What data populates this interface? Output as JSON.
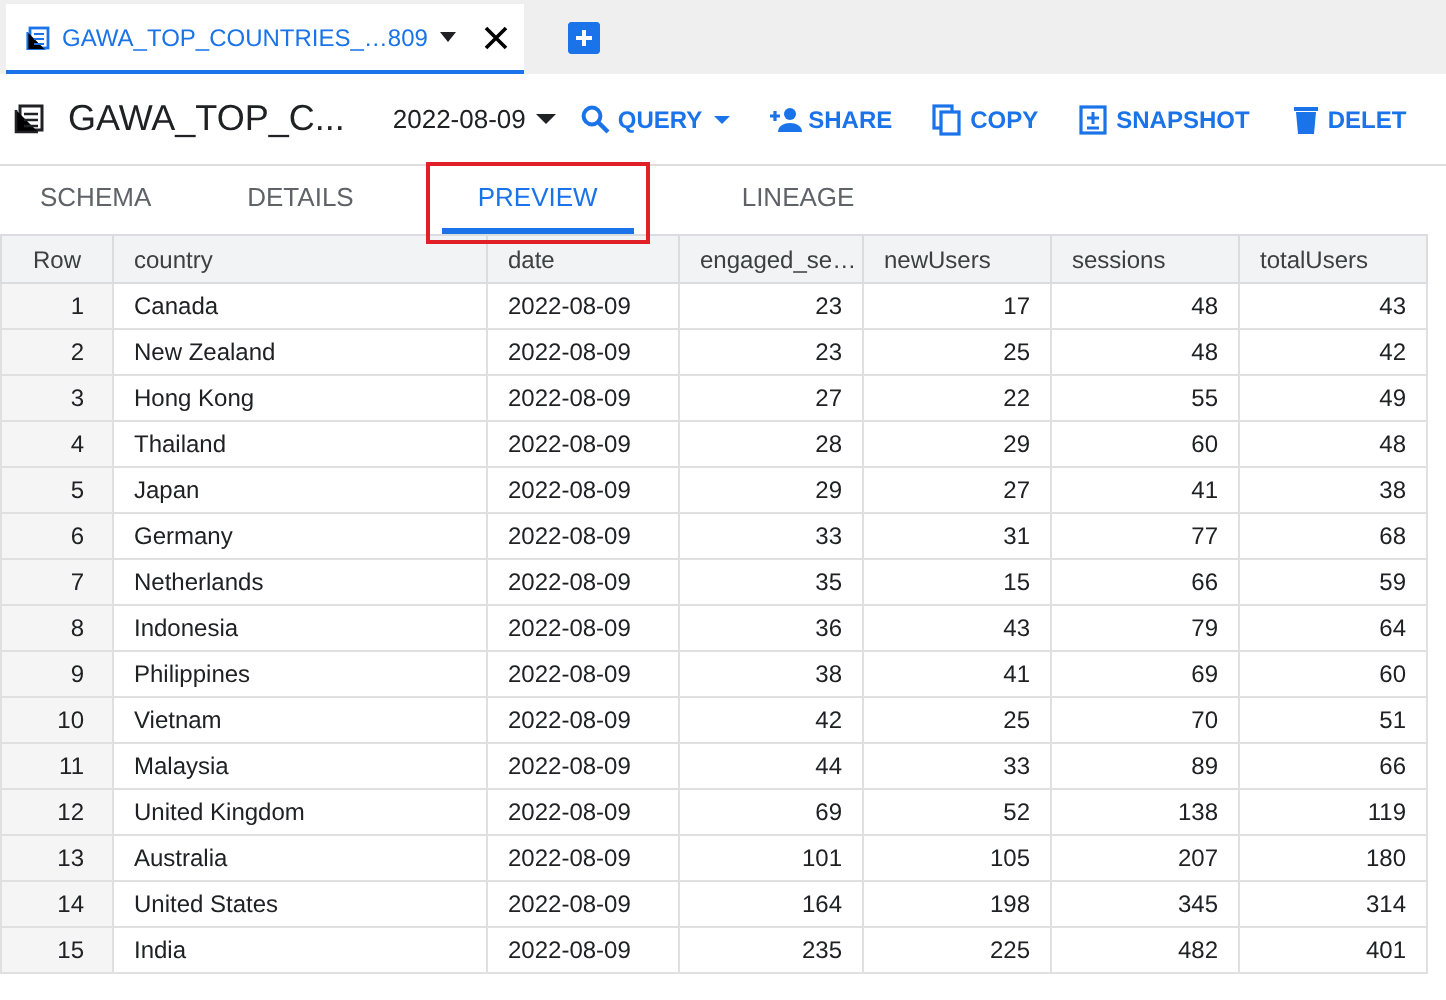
{
  "editor_tab": {
    "title": "GAWA_TOP_COUNTRIES_…809",
    "selected": true
  },
  "header": {
    "title": "GAWA_TOP_C...",
    "date": "2022-08-09",
    "actions": [
      {
        "label": "QUERY",
        "kind": "menu"
      },
      {
        "label": "SHARE",
        "kind": "plain"
      },
      {
        "label": "COPY",
        "kind": "plain"
      },
      {
        "label": "SNAPSHOT",
        "kind": "plain"
      },
      {
        "label": "DELET",
        "kind": "plain"
      }
    ]
  },
  "tabs": [
    {
      "label": "SCHEMA",
      "selected": false,
      "highlighted": false
    },
    {
      "label": "DETAILS",
      "selected": false,
      "highlighted": false
    },
    {
      "label": "PREVIEW",
      "selected": true,
      "highlighted": true
    },
    {
      "label": "LINEAGE",
      "selected": false,
      "highlighted": false
    }
  ],
  "table": {
    "columns": [
      "Row",
      "country",
      "date",
      "engaged_se…",
      "newUsers",
      "sessions",
      "totalUsers"
    ],
    "rows": [
      [
        "1",
        "Canada",
        "2022-08-09",
        "23",
        "17",
        "48",
        "43"
      ],
      [
        "2",
        "New Zealand",
        "2022-08-09",
        "23",
        "25",
        "48",
        "42"
      ],
      [
        "3",
        "Hong Kong",
        "2022-08-09",
        "27",
        "22",
        "55",
        "49"
      ],
      [
        "4",
        "Thailand",
        "2022-08-09",
        "28",
        "29",
        "60",
        "48"
      ],
      [
        "5",
        "Japan",
        "2022-08-09",
        "29",
        "27",
        "41",
        "38"
      ],
      [
        "6",
        "Germany",
        "2022-08-09",
        "33",
        "31",
        "77",
        "68"
      ],
      [
        "7",
        "Netherlands",
        "2022-08-09",
        "35",
        "15",
        "66",
        "59"
      ],
      [
        "8",
        "Indonesia",
        "2022-08-09",
        "36",
        "43",
        "79",
        "64"
      ],
      [
        "9",
        "Philippines",
        "2022-08-09",
        "38",
        "41",
        "69",
        "60"
      ],
      [
        "10",
        "Vietnam",
        "2022-08-09",
        "42",
        "25",
        "70",
        "51"
      ],
      [
        "11",
        "Malaysia",
        "2022-08-09",
        "44",
        "33",
        "89",
        "66"
      ],
      [
        "12",
        "United Kingdom",
        "2022-08-09",
        "69",
        "52",
        "138",
        "119"
      ],
      [
        "13",
        "Australia",
        "2022-08-09",
        "101",
        "105",
        "207",
        "180"
      ],
      [
        "14",
        "United States",
        "2022-08-09",
        "164",
        "198",
        "345",
        "314"
      ],
      [
        "15",
        "India",
        "2022-08-09",
        "235",
        "225",
        "482",
        "401"
      ]
    ]
  }
}
